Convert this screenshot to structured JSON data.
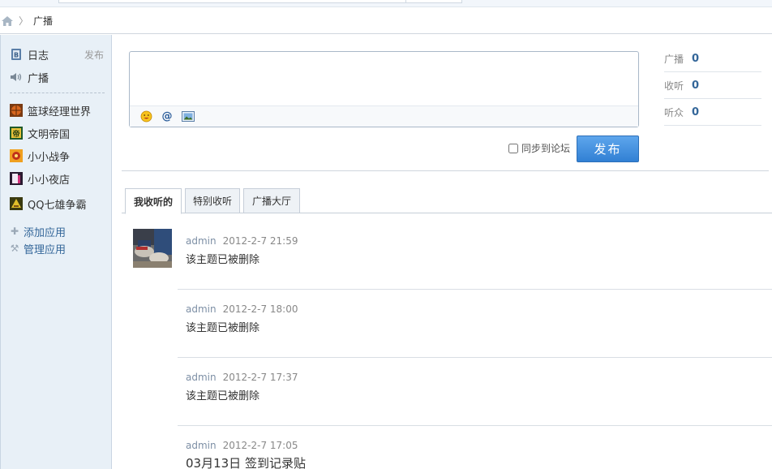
{
  "breadcrumb": {
    "current": "广播"
  },
  "sidebar": {
    "publish_label": "发布",
    "items": [
      {
        "label": "日志",
        "icon": "blog-icon"
      },
      {
        "label": "广播",
        "icon": "speaker-icon"
      },
      {
        "label": "篮球经理世界",
        "icon": "basketball-game-icon"
      },
      {
        "label": "文明帝国",
        "icon": "empire-game-icon"
      },
      {
        "label": "小小战争",
        "icon": "war-game-icon"
      },
      {
        "label": "小小夜店",
        "icon": "nightclub-game-icon"
      },
      {
        "label": "QQ七雄争霸",
        "icon": "qq-game-icon"
      }
    ],
    "add_app": "添加应用",
    "manage_app": "管理应用"
  },
  "composer": {
    "text": "",
    "sync_label": "同步到论坛",
    "sync_checked": false,
    "submit_label": "发布"
  },
  "stats": [
    {
      "label": "广播",
      "value": "0"
    },
    {
      "label": "收听",
      "value": "0"
    },
    {
      "label": "听众",
      "value": "0"
    }
  ],
  "tabs": [
    {
      "label": "我收听的",
      "active": true
    },
    {
      "label": "特别收听",
      "active": false
    },
    {
      "label": "广播大厅",
      "active": false
    }
  ],
  "feed": [
    {
      "user": "admin",
      "time": "2012-2-7 21:59",
      "content": "该主题已被删除"
    },
    {
      "user": "admin",
      "time": "2012-2-7 18:00",
      "content": "该主题已被删除"
    },
    {
      "user": "admin",
      "time": "2012-2-7 17:37",
      "content": "该主题已被删除"
    },
    {
      "user": "admin",
      "time": "2012-2-7 17:05",
      "content": "03月13日 签到记录贴"
    }
  ],
  "colors": {
    "accent": "#336699",
    "button": "#3180d4",
    "sidebar_bg": "#e8f0f7"
  }
}
